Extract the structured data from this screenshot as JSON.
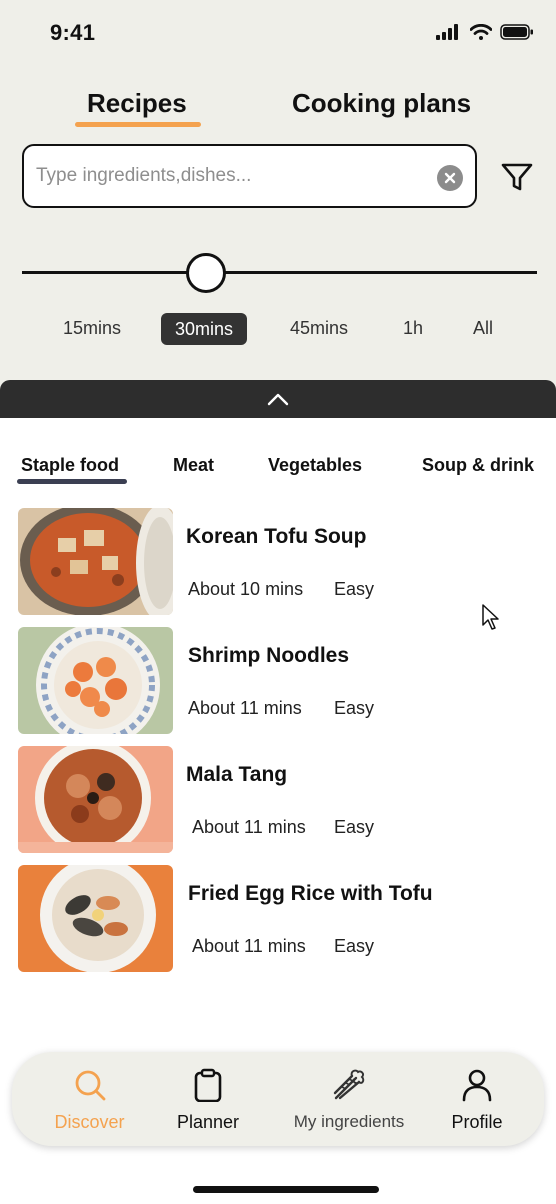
{
  "status_bar": {
    "time": "9:41"
  },
  "top_tabs": {
    "recipes": "Recipes",
    "cooking_plans": "Cooking plans"
  },
  "search": {
    "placeholder": "Type ingredients,dishes...",
    "value": ""
  },
  "time_filter": {
    "options": [
      "15mins",
      "30mins",
      "45mins",
      "1h",
      "All"
    ],
    "selected": "30mins"
  },
  "categories": [
    "Staple food",
    "Meat",
    "Vegetables",
    "Soup & drink"
  ],
  "recipes": [
    {
      "title": "Korean Tofu Soup",
      "time": "About 10 mins",
      "difficulty": "Easy"
    },
    {
      "title": "Shrimp Noodles",
      "time": "About 11 mins",
      "difficulty": "Easy"
    },
    {
      "title": "Mala Tang",
      "time": "About 11 mins",
      "difficulty": "Easy"
    },
    {
      "title": "Fried Egg Rice with Tofu",
      "time": "About 11 mins",
      "difficulty": "Easy"
    }
  ],
  "bottom_nav": {
    "discover": "Discover",
    "planner": "Planner",
    "my_ingredients": "My ingredients",
    "profile": "Profile"
  },
  "colors": {
    "accent": "#f4a24f",
    "top_background": "#efefe9",
    "dark": "#2d2d2d"
  },
  "icons": [
    "signal-icon",
    "wifi-icon",
    "battery-icon",
    "clear-icon",
    "filter-icon",
    "chevron-up-icon",
    "search-icon",
    "clipboard-icon",
    "celery-icon",
    "user-icon",
    "cursor-icon"
  ]
}
